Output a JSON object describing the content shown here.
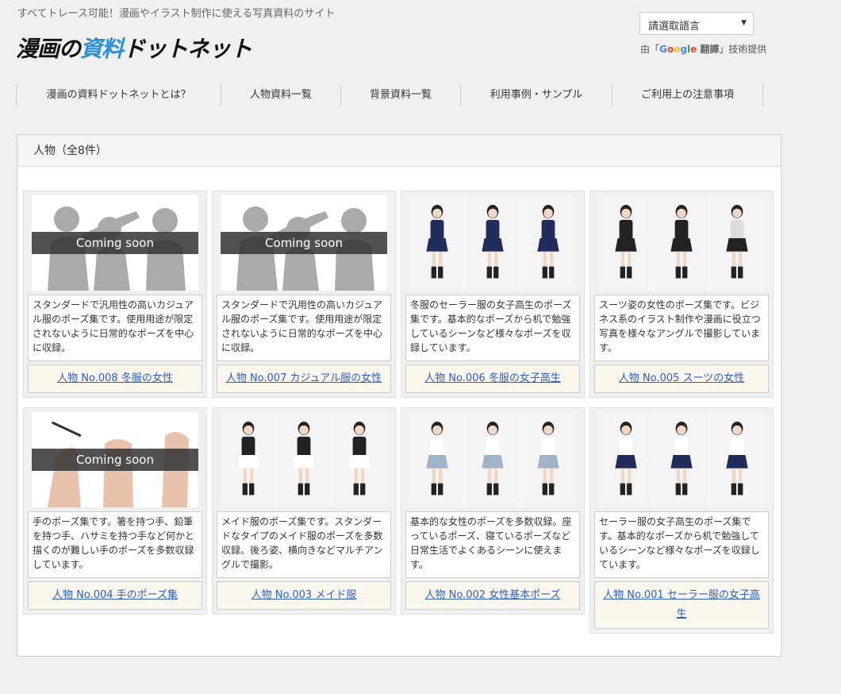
{
  "header": {
    "tagline": "すべてトレース可能！漫画やイラスト制作に使える写真資料のサイト",
    "logo_part1": "漫画の",
    "logo_part2": "資料",
    "logo_part3": "ドットネット",
    "language_select": "請選取語言",
    "gt_prefix": "由「",
    "gt_brand": [
      "G",
      "o",
      "o",
      "g",
      "l",
      "e"
    ],
    "gt_translate": " 翻譯",
    "gt_suffix": "」技術提供"
  },
  "nav": {
    "items": [
      "漫画の資料ドットネットとは？",
      "人物資料一覧",
      "背景資料一覧",
      "利用事例・サンプル",
      "ご利用上の注意事項"
    ]
  },
  "panel": {
    "heading": "人物（全8件）"
  },
  "cards": [
    {
      "thumb": "silhouette",
      "overlay": "Coming soon",
      "desc": "スタンダードで汎用性の高いカジュアル服のポーズ集です。使用用途が限定されないように日常的なポーズを中心に収録。",
      "title": "人物 No.008 冬服の女性"
    },
    {
      "thumb": "silhouette",
      "overlay": "Coming soon",
      "desc": "スタンダードで汎用性の高いカジュアル服のポーズ集です。使用用途が限定されないように日常的なポーズを中心に収録。",
      "title": "人物 No.007 カジュアル服の女性"
    },
    {
      "thumb": "sailor-winter",
      "overlay": "",
      "desc": "冬服のセーラー服の女子高生のポーズ集です。基本的なポーズから机で勉強しているシーンなど様々なポーズを収録しています。",
      "title": "人物 No.006 冬服の女子高生"
    },
    {
      "thumb": "suit",
      "overlay": "",
      "desc": "スーツ姿の女性のポーズ集です。ビジネス系のイラスト制作や漫画に役立つ写真を様々なアングルで撮影しています。",
      "title": "人物 No.005 スーツの女性"
    },
    {
      "thumb": "hands",
      "overlay": "Coming soon",
      "desc": "手のポーズ集です。箸を持つ手、鉛筆を持つ手、ハサミを持つ手など何かと描くのが難しい手のポーズを多数収録しています。",
      "title": "人物 No.004 手のポーズ集"
    },
    {
      "thumb": "maid",
      "overlay": "",
      "desc": "メイド服のポーズ集です。スタンダードなタイプのメイド服のポーズを多数収録。後ろ姿、横向きなどマルチアングルで撮影。",
      "title": "人物 No.003 メイド服"
    },
    {
      "thumb": "basic",
      "overlay": "",
      "desc": "基本的な女性のポーズを多数収録。座っているポーズ、寝ているポーズなど日常生活でよくあるシーンに使えます。",
      "title": "人物 No.002 女性基本ポーズ"
    },
    {
      "thumb": "sailor-summer",
      "overlay": "",
      "desc": "セーラー服の女子高生のポーズ集です。基本的なポーズから机で勉強しているシーンなど様々なポーズを収録しています。",
      "title": "人物 No.001 セーラー服の女子高生"
    }
  ],
  "colors": {
    "accent": "#2a8fd6",
    "link": "#2b5fc7",
    "title_bg": "#fbf7ec"
  }
}
